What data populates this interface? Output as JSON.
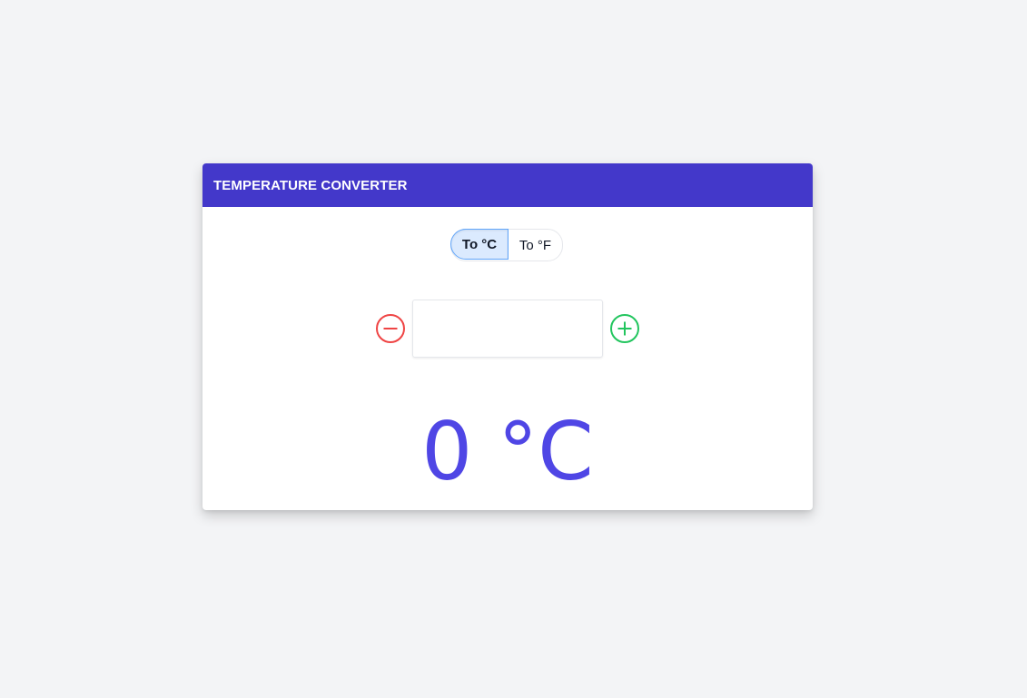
{
  "header": {
    "title": "TEMPERATURE CONVERTER",
    "color": "#4338ca"
  },
  "toggle": {
    "options": [
      {
        "label": "To °C",
        "selected": true
      },
      {
        "label": "To °F",
        "selected": false
      }
    ]
  },
  "stepper": {
    "decrement_icon": "minus-circle-icon",
    "increment_icon": "plus-circle-icon",
    "decrement_color": "#ef4444",
    "increment_color": "#22c55e",
    "input_value": "",
    "input_placeholder": ""
  },
  "result": {
    "display": "0 °C",
    "color": "#4f46e5"
  }
}
